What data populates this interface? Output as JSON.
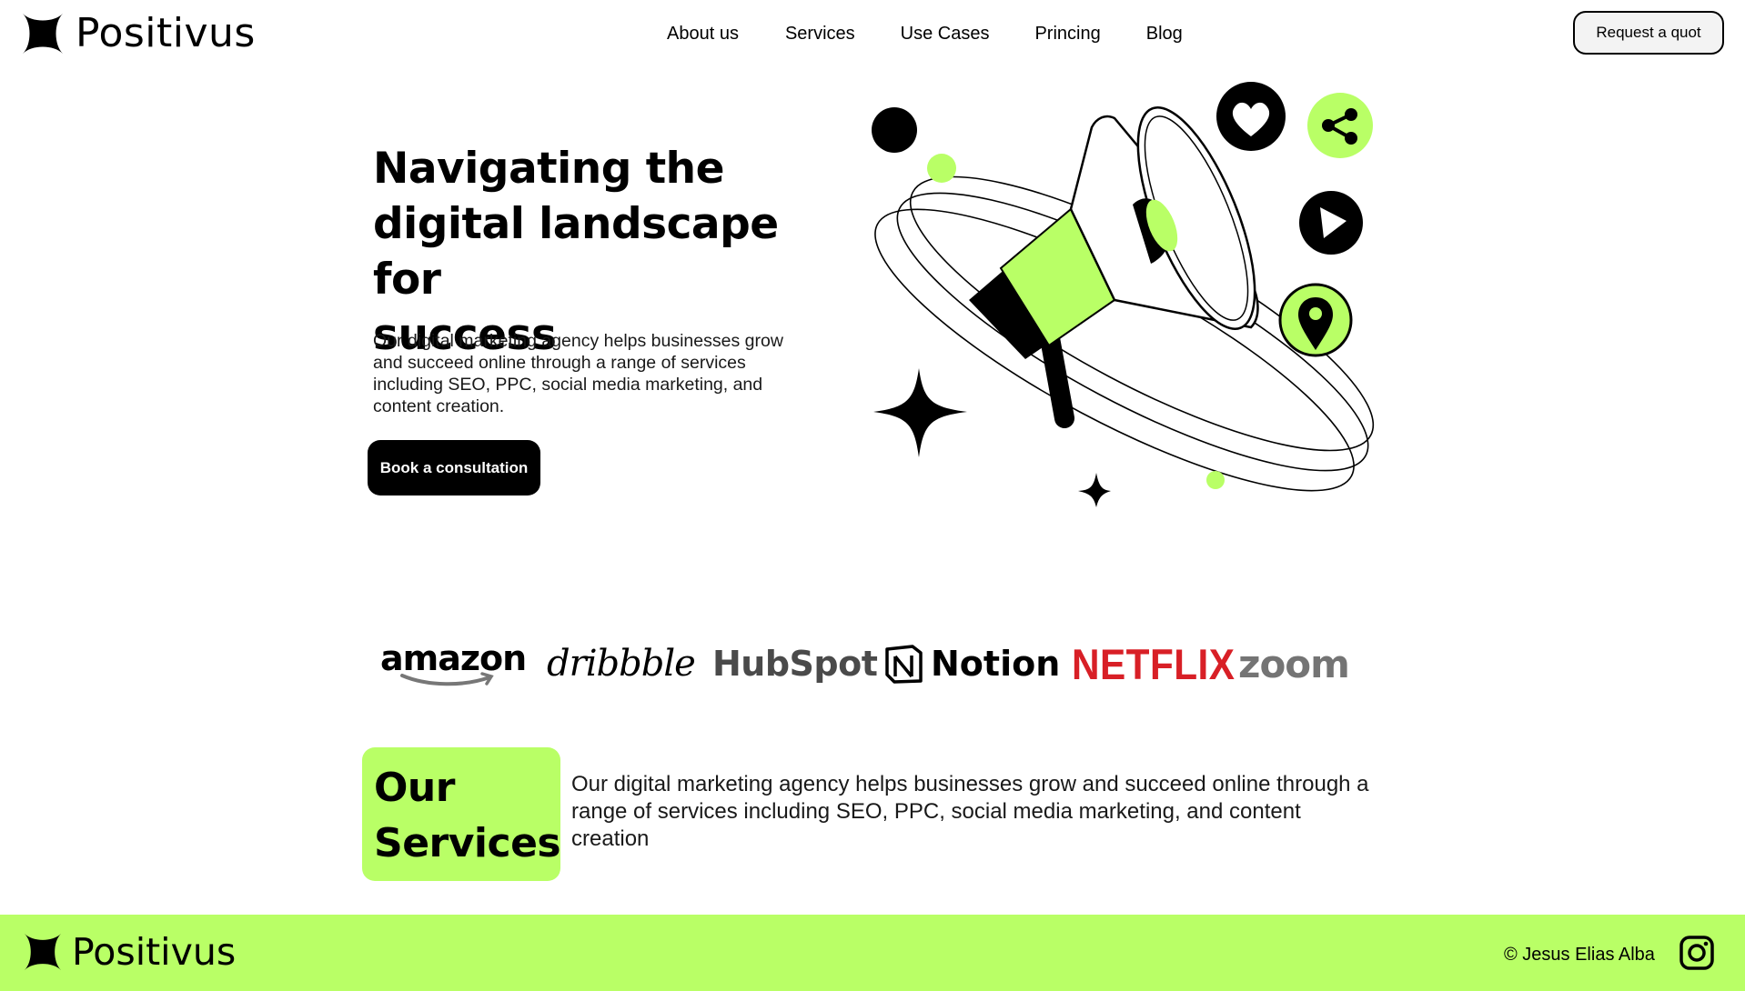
{
  "header": {
    "brand": "Positivus",
    "nav": [
      "About us",
      "Services",
      "Use Cases",
      "Princing",
      "Blog"
    ],
    "cta": "Request a quot"
  },
  "hero": {
    "title_lines": [
      "Navigating the",
      "digital landscape for",
      "success"
    ],
    "description": "Our digital marketing agency helps businesses grow and succeed online through a range of services including SEO, PPC, social media marketing, and content creation.",
    "button": "Book a consultation"
  },
  "partners": [
    "amazon",
    "dribbble",
    "HubSpot",
    "Notion",
    "NETFLIX",
    "zoom"
  ],
  "services": {
    "badge_lines": [
      "Our",
      "Services"
    ],
    "description": "Our digital marketing agency helps businesses grow and succeed online through a range of services including SEO, PPC, social media marketing, and content creation"
  },
  "footer": {
    "brand": "Positivus",
    "copyright": "© Jesus Elias Alba"
  },
  "icons": {
    "logo": "star-sparkle-icon",
    "hero_icons": [
      "heart-icon",
      "share-icon",
      "play-icon",
      "location-pin-icon",
      "megaphone-icon",
      "sparkle-icon"
    ],
    "footer": "instagram-icon"
  },
  "colors": {
    "accent": "#b9ff66",
    "dark": "#000000",
    "netflix": "#d81f26",
    "button_light": "#f3f3f3"
  }
}
